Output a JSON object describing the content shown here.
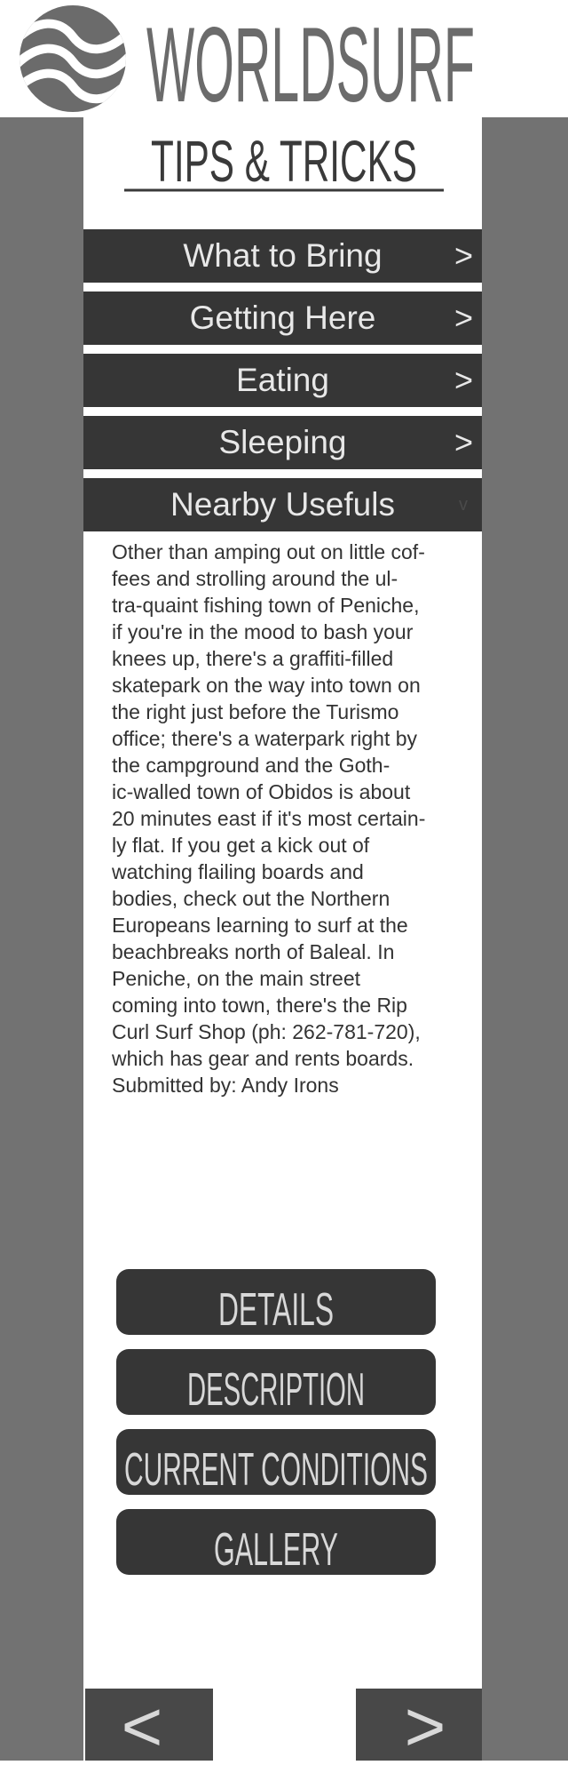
{
  "brand": {
    "name": "WORLDSURF",
    "logo_icon": "waves-icon"
  },
  "page_title": "TIPS & TRICKS",
  "accordion": [
    {
      "label": "What to Bring",
      "arrow": ">"
    },
    {
      "label": "Getting Here",
      "arrow": ">"
    },
    {
      "label": "Eating",
      "arrow": ">"
    },
    {
      "label": "Sleeping",
      "arrow": ">"
    },
    {
      "label": "Nearby Usefuls",
      "arrow": "v"
    }
  ],
  "panel": {
    "lines": [
      "Other than amping out on little cof-",
      "fees and strolling around the ul-",
      "tra-quaint fishing town of Peniche,",
      "if you're in the mood to bash your",
      "knees up, there's a graffiti-filled",
      "skatepark on the way into town on",
      "the right just before the Turismo",
      "office; there's a waterpark right by",
      "the campground and the Goth-",
      "ic-walled town of Obidos is about",
      "20 minutes east if it's most certain-",
      "ly flat. If you get a kick out of",
      "watching flailing boards and",
      "bodies, check out the Northern",
      "Europeans learning to surf at the",
      "beachbreaks north of Baleal. In",
      "Peniche, on the main street",
      "coming into town, there's the Rip",
      "Curl Surf Shop (ph: 262-781-720),",
      "which has gear and rents boards.",
      "Submitted by: Andy Irons"
    ]
  },
  "buttons": {
    "details": "DETAILS",
    "description": "DESCRIPTION",
    "current_conditions": "CURRENT CONDITIONS",
    "gallery": "GALLERY"
  },
  "nav": {
    "prev": "<",
    "next": ">",
    "prev_icon": "chevron-left-icon",
    "next_icon": "chevron-right-icon"
  },
  "colors": {
    "dark": "#363636",
    "side": "#727272",
    "brand_gray": "#6b6b6b",
    "nav": "#484848"
  }
}
